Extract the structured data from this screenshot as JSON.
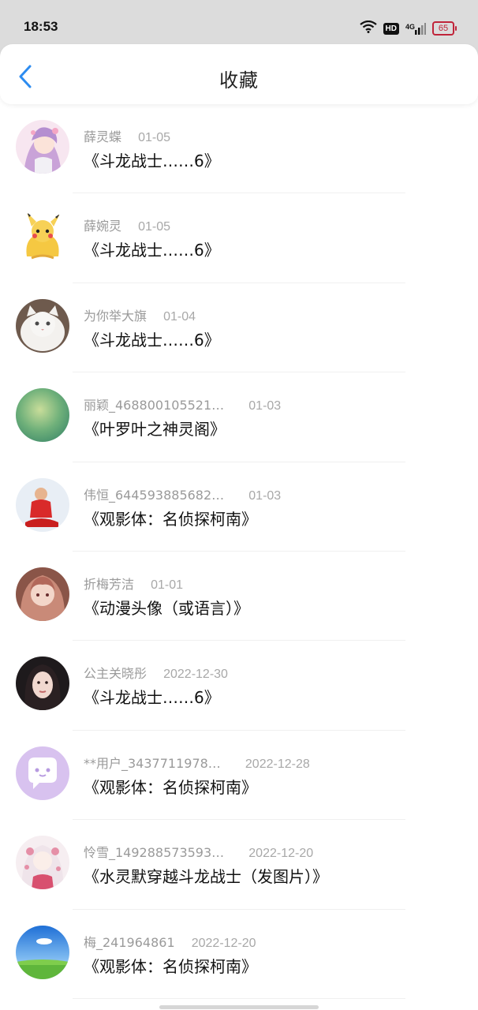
{
  "status_bar": {
    "time": "18:53",
    "network": "4G",
    "hd_label": "HD",
    "battery": "65",
    "icons": [
      "wifi-icon",
      "hd-icon",
      "signal-icon",
      "battery-icon"
    ]
  },
  "header": {
    "title": "收藏",
    "back_icon": "chevron-left-icon",
    "accent": "#2d8cf0"
  },
  "favorites": [
    {
      "user": "薛灵蝶",
      "date": "01-05",
      "title": "《斗龙战士……6》",
      "avatar": "anime-girl-pink"
    },
    {
      "user": "薛婉灵",
      "date": "01-05",
      "title": "《斗龙战士……6》",
      "avatar": "pikachu"
    },
    {
      "user": "为你举大旗",
      "date": "01-04",
      "title": "《斗龙战士……6》",
      "avatar": "white-cat"
    },
    {
      "user": "丽颖_468800105521…",
      "date": "01-03",
      "title": "《叶罗叶之神灵阁》",
      "avatar": "green-gradient"
    },
    {
      "user": "伟恒_644593885682…",
      "date": "01-03",
      "title": "《观影体：名侦探柯南》",
      "avatar": "boy-red"
    },
    {
      "user": "折梅芳洁",
      "date": "01-01",
      "title": "《动漫头像（或语言）》",
      "avatar": "anime-brown"
    },
    {
      "user": "公主关晓彤",
      "date": "2022-12-30",
      "title": "《斗龙战士……6》",
      "avatar": "woman-portrait"
    },
    {
      "user": "**用户_3437711978…",
      "date": "2022-12-28",
      "title": "《观影体：名侦探柯南》",
      "avatar": "chat-bubble-purple"
    },
    {
      "user": "怜雪_149288573593…",
      "date": "2022-12-20",
      "title": "《水灵默穿越斗龙战士（发图片）》",
      "avatar": "anime-white-pink"
    },
    {
      "user": "梅_241964861",
      "date": "2022-12-20",
      "title": "《观影体：名侦探柯南》",
      "avatar": "sky-grass"
    }
  ]
}
